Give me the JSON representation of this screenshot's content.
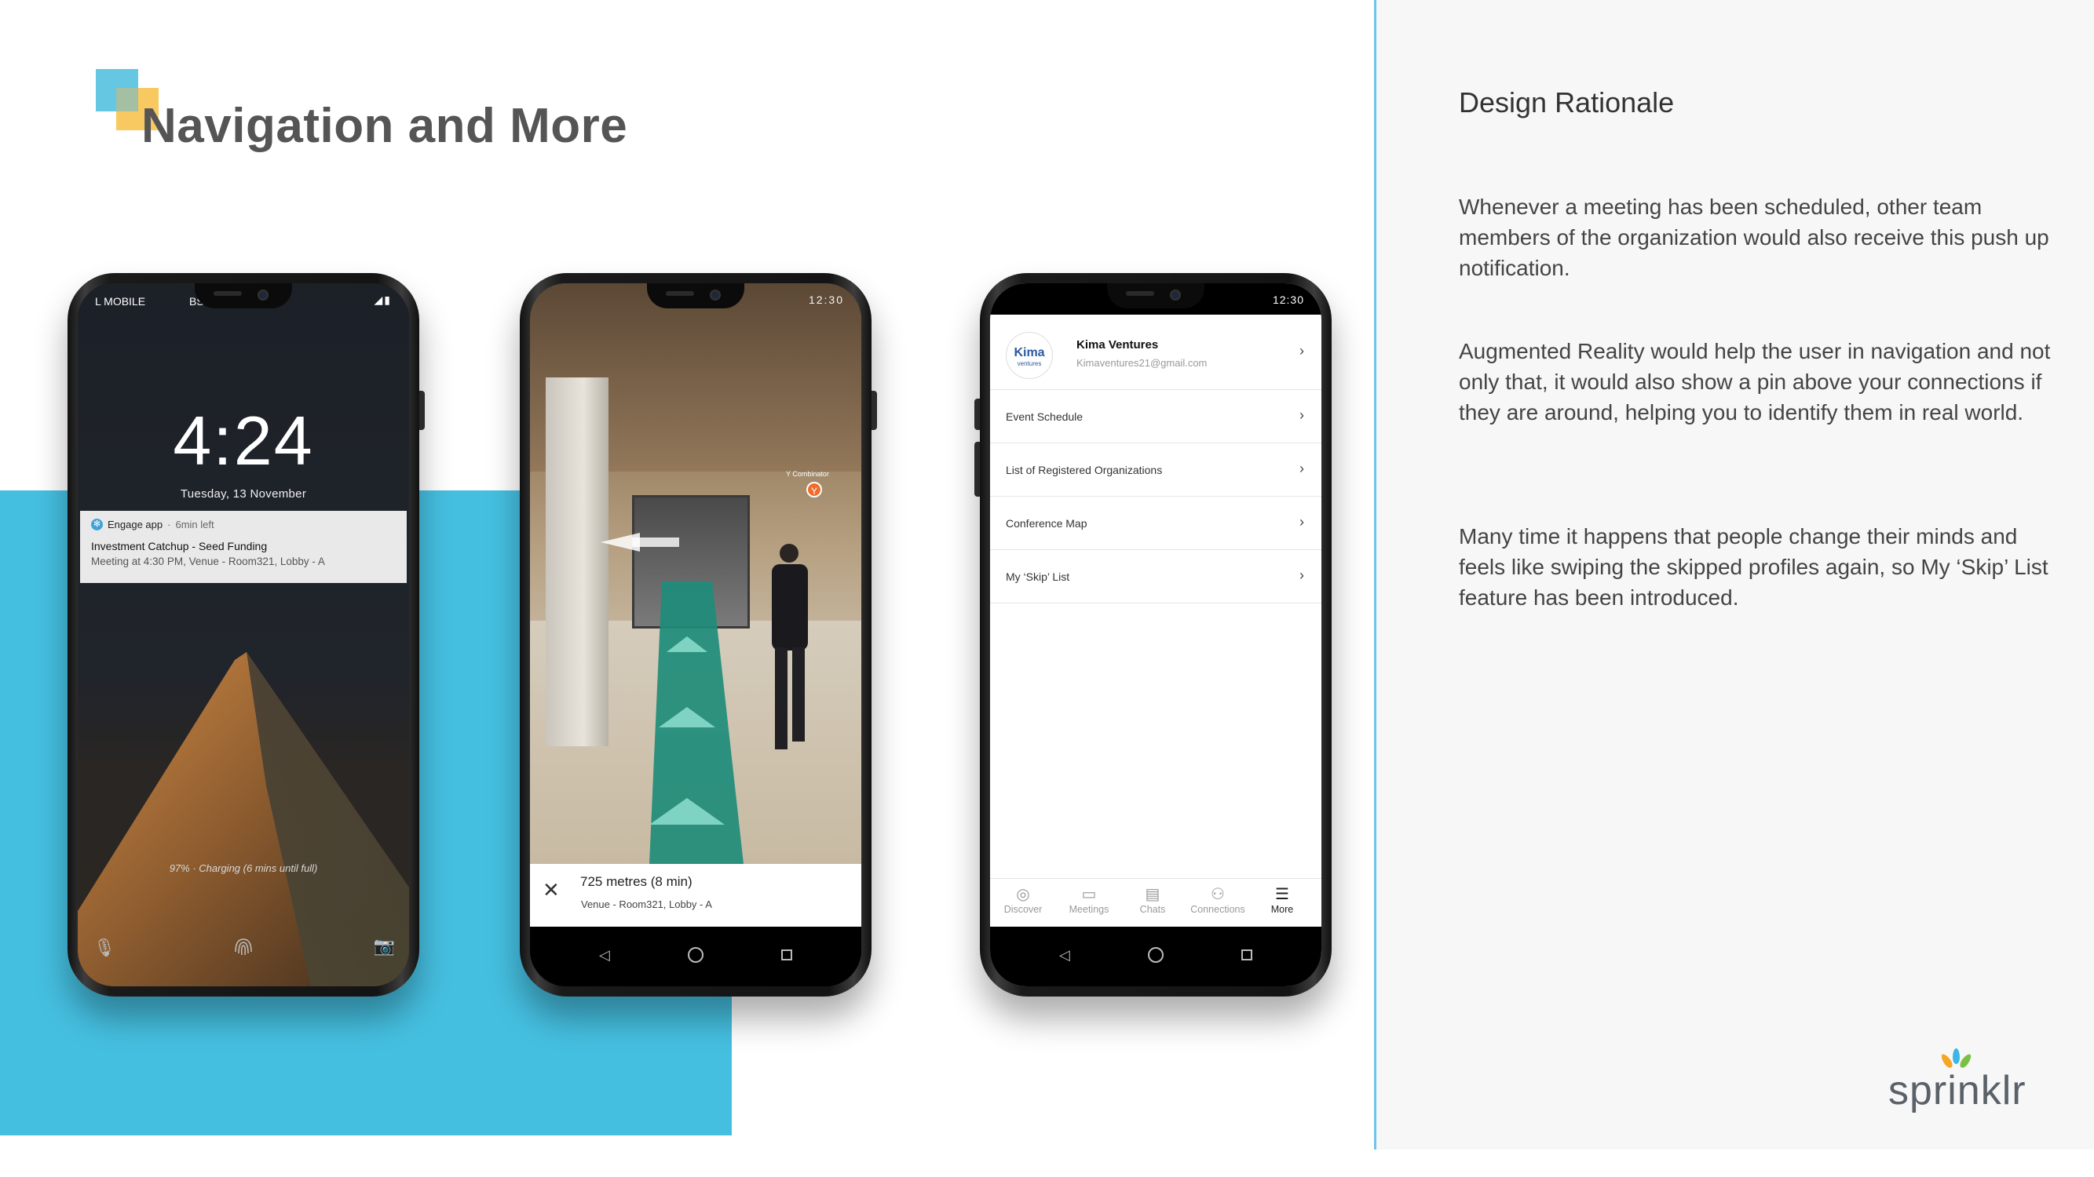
{
  "slide": {
    "title": "Navigation and More",
    "brand": "sprinklr"
  },
  "design_rationale": {
    "heading": "Design Rationale",
    "paragraphs": [
      "Whenever a meeting has been scheduled, other team members of the organization would also receive this push up notification.",
      "Augmented Reality would help the user in navigation and not only that, it would also show a pin above your connections if they are around, helping you to identify them in real world.",
      "Many time it happens that people change their minds and feels like swiping the skipped profiles again, so My ‘Skip’ List feature has been introduced."
    ]
  },
  "phone1": {
    "carrier": "L MOBILE",
    "carrier2": "BS",
    "lock_time": "4:24",
    "lock_date": "Tuesday, 13 November",
    "notification": {
      "app": "Engage app",
      "ago": "6min left",
      "title": "Investment Catchup - Seed Funding",
      "body": "Meeting at 4:30 PM, Venue - Room321, Lobby - A"
    },
    "charging": "97% · Charging (6 mins until full)"
  },
  "phone2": {
    "status_time": "12:30",
    "pin_label": "Y Combinator",
    "pin_letter": "Y",
    "distance": "725 metres (8 min)",
    "venue": "Venue - Room321, Lobby - A"
  },
  "phone3": {
    "status_time": "12:30",
    "profile": {
      "name": "Kima Ventures",
      "email": "Kimaventures21@gmail.com",
      "avatar_text": "Kima",
      "avatar_sub": "ventures"
    },
    "menu": [
      {
        "label": "Event Schedule"
      },
      {
        "label": "List of Registered Organizations"
      },
      {
        "label": "Conference Map"
      },
      {
        "label": "My ‘Skip’ List"
      }
    ],
    "tabs": [
      {
        "label": "Discover",
        "icon": "compass-icon"
      },
      {
        "label": "Meetings",
        "icon": "calendar-icon"
      },
      {
        "label": "Chats",
        "icon": "chat-icon"
      },
      {
        "label": "Connections",
        "icon": "people-icon"
      },
      {
        "label": "More",
        "icon": "menu-icon",
        "active": true
      }
    ]
  },
  "colors": {
    "accent_blue": "#45bfe0",
    "logo_yellow": "#f7c453",
    "ar_path": "#1e8c7a"
  }
}
